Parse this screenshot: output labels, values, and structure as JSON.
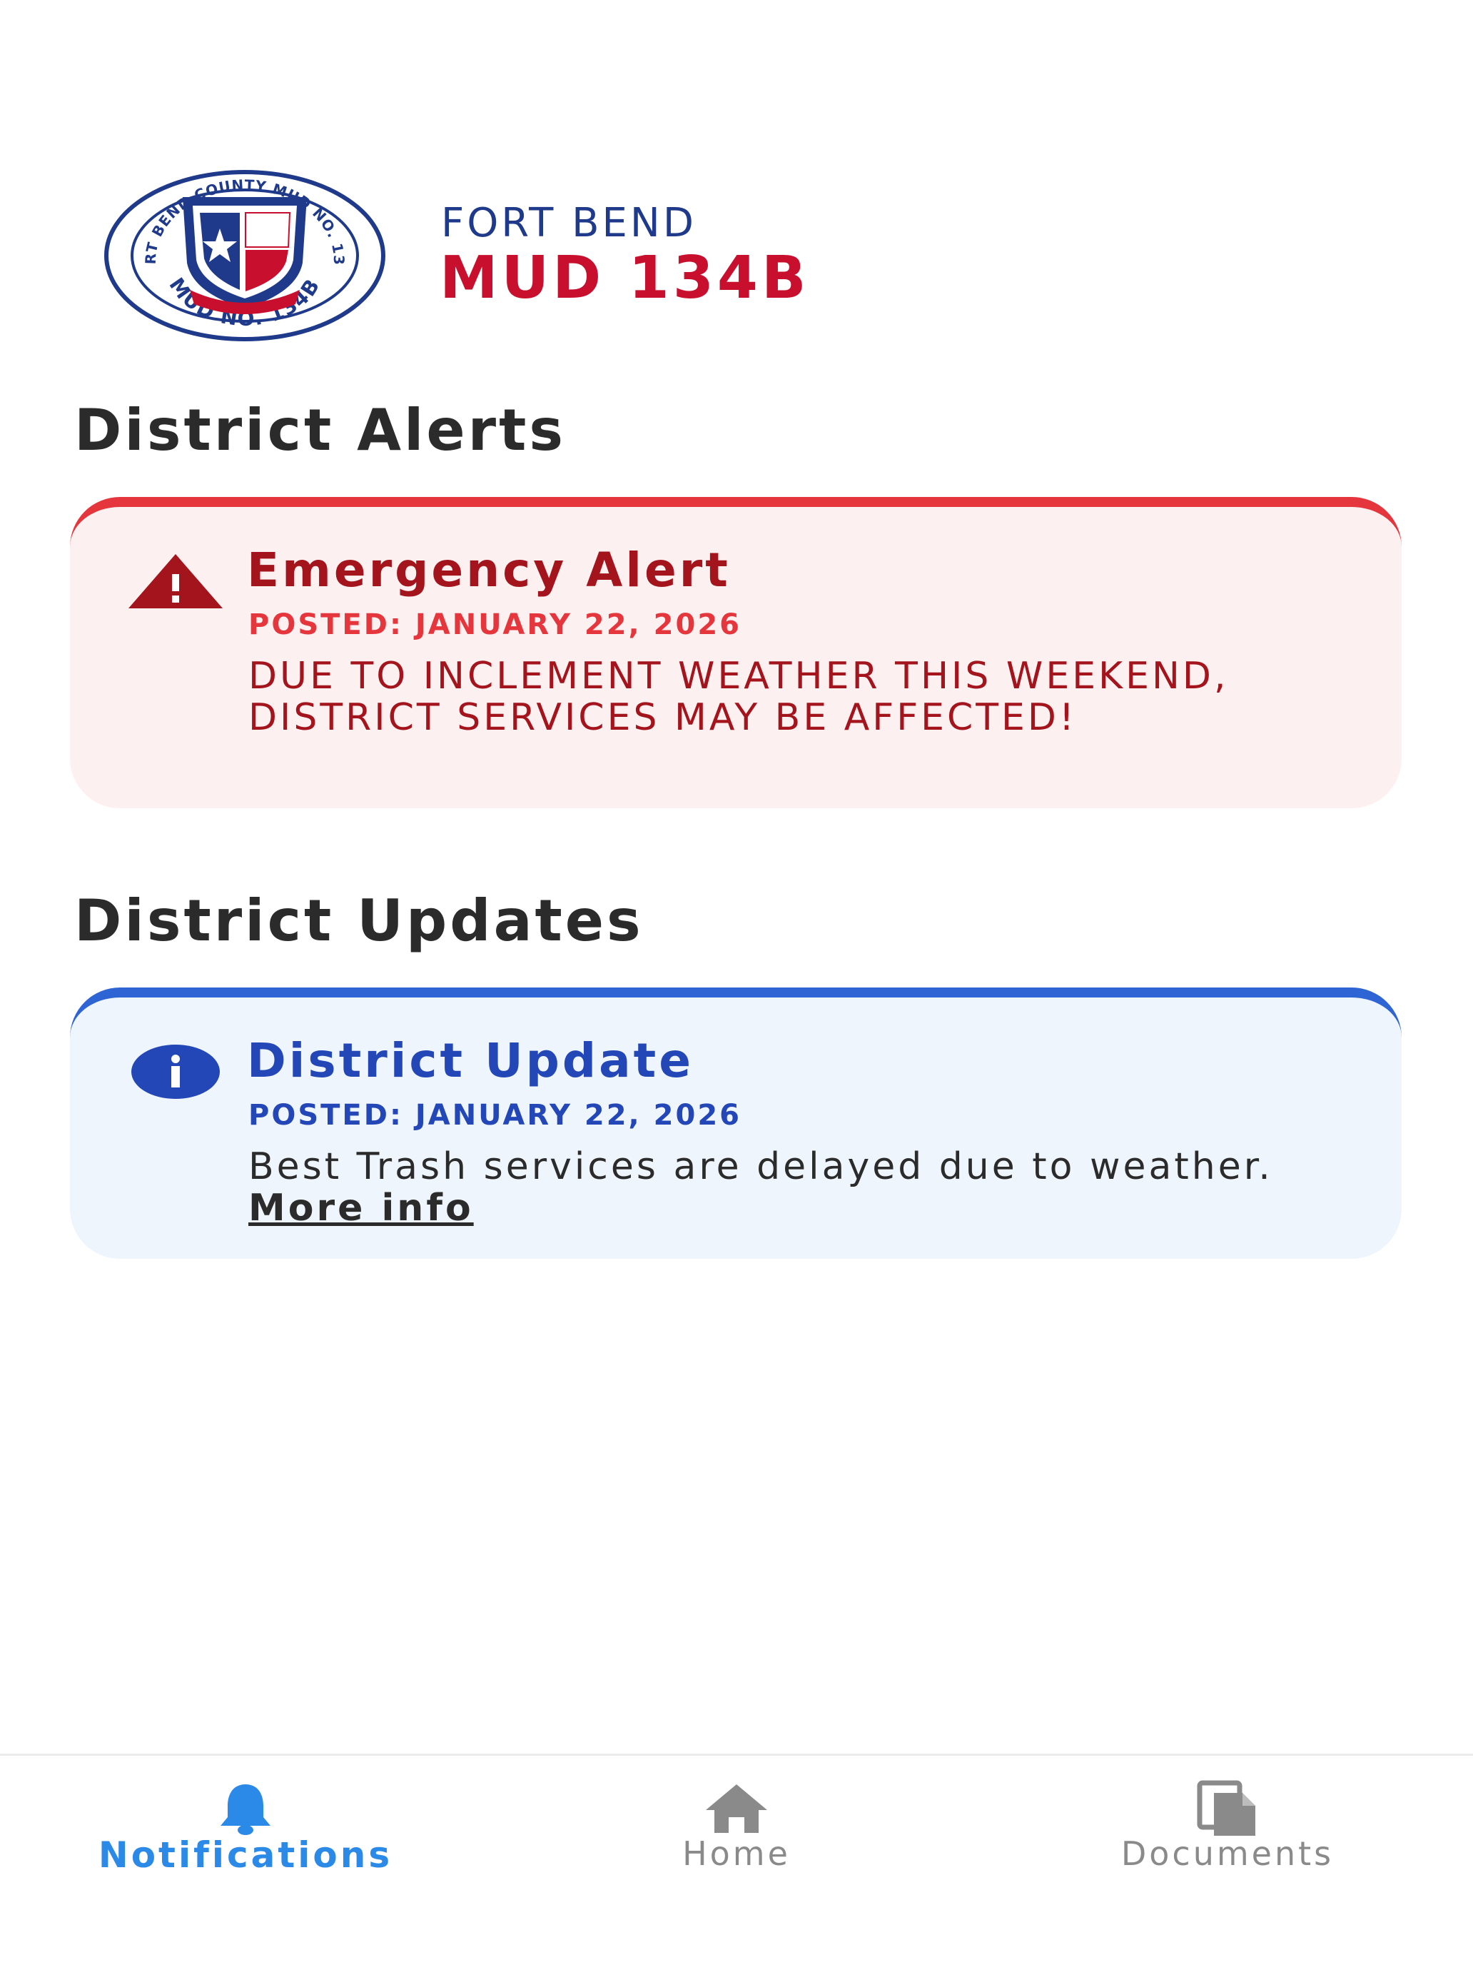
{
  "header": {
    "logo": {
      "ring_text_top": "FORT BEND COUNTY MUD NO. 134B",
      "ring_text_bottom": "MUD NO. 134B"
    },
    "brand_top": "FORT BEND",
    "brand_main": "MUD 134B"
  },
  "alerts": {
    "section_title": "District Alerts",
    "card": {
      "icon": "warning-triangle-icon",
      "title": "Emergency Alert",
      "posted": "POSTED: JANUARY 22, 2026",
      "body": "DUE TO INCLEMENT WEATHER THIS WEEKEND, DISTRICT SERVICES MAY BE AFFECTED!"
    }
  },
  "updates": {
    "section_title": "District Updates",
    "card": {
      "icon": "info-icon",
      "title": "District Update",
      "posted": "POSTED: JANUARY 22, 2026",
      "body": "Best Trash services are delayed due to weather.",
      "link_label": "More info"
    }
  },
  "tabs": [
    {
      "label": "Notifications",
      "icon": "bell-icon",
      "active": true
    },
    {
      "label": "Home",
      "icon": "home-icon",
      "active": false
    },
    {
      "label": "Documents",
      "icon": "documents-icon",
      "active": false
    }
  ],
  "colors": {
    "alert_accent": "#e5363d",
    "alert_text": "#a3141d",
    "alert_bg": "#fdf0f0",
    "update_accent": "#2f64d4",
    "update_text": "#2447b8",
    "update_bg": "#eff5fd",
    "brand_red": "#c8102e",
    "brand_blue": "#1f3a8a",
    "tab_active": "#2b8ae8",
    "tab_inactive": "#8a8a8a"
  }
}
